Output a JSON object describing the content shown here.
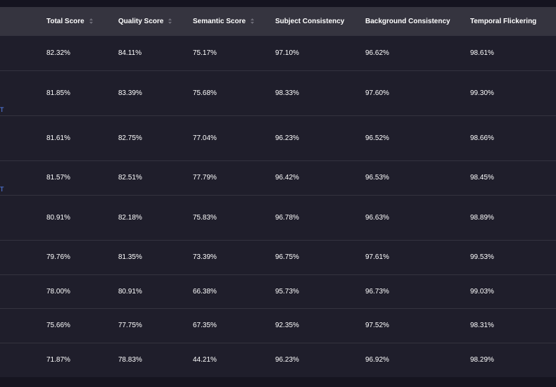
{
  "columns": [
    {
      "label": "",
      "sortable": false
    },
    {
      "label": "Total Score",
      "sortable": true
    },
    {
      "label": "Quality Score",
      "sortable": true
    },
    {
      "label": "Semantic Score",
      "sortable": true
    },
    {
      "label": "Subject Consistency",
      "sortable": false
    },
    {
      "label": "Background Consistency",
      "sortable": false
    },
    {
      "label": "Temporal Flickering",
      "sortable": false
    }
  ],
  "rows": [
    {
      "link": "",
      "cells": [
        "82.32%",
        "84.11%",
        "75.17%",
        "97.10%",
        "96.62%",
        "98.61%"
      ]
    },
    {
      "link": "",
      "cells": [
        "81.85%",
        "83.39%",
        "75.68%",
        "98.33%",
        "97.60%",
        "99.30%"
      ]
    },
    {
      "link": "T",
      "cells": [
        "81.61%",
        "82.75%",
        "77.04%",
        "96.23%",
        "96.52%",
        "98.66%"
      ]
    },
    {
      "link": "",
      "cells": [
        "81.57%",
        "82.51%",
        "77.79%",
        "96.42%",
        "96.53%",
        "98.45%"
      ]
    },
    {
      "link": "T",
      "cells": [
        "80.91%",
        "82.18%",
        "75.83%",
        "96.78%",
        "96.63%",
        "98.89%"
      ]
    },
    {
      "link": "",
      "cells": [
        "79.76%",
        "81.35%",
        "73.39%",
        "96.75%",
        "97.61%",
        "99.53%"
      ]
    },
    {
      "link": "",
      "cells": [
        "78.00%",
        "80.91%",
        "66.38%",
        "95.73%",
        "96.73%",
        "99.03%"
      ]
    },
    {
      "link": "",
      "cells": [
        "75.66%",
        "77.75%",
        "67.35%",
        "92.35%",
        "97.52%",
        "98.31%"
      ]
    },
    {
      "link": "",
      "cells": [
        "71.87%",
        "78.83%",
        "44.21%",
        "96.23%",
        "96.92%",
        "98.29%"
      ]
    }
  ],
  "colors": {
    "header_bg": "#35343f",
    "row_bg": "#1f1e2b",
    "divider": "#34333f",
    "link": "#5b8cff"
  }
}
